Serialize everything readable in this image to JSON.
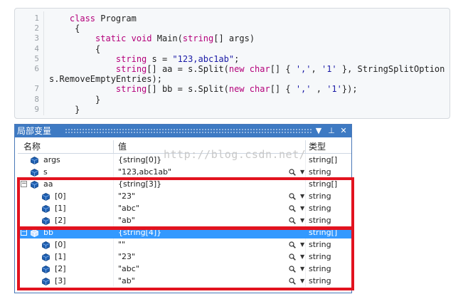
{
  "code": {
    "line_numbers": [
      "1",
      "2",
      "3",
      "4",
      "5",
      "6",
      "",
      "7",
      "8",
      "9"
    ],
    "lines": [
      [
        {
          "t": "    "
        },
        {
          "t": "class",
          "c": "kw"
        },
        {
          "t": " Program"
        }
      ],
      [
        {
          "t": "     {"
        }
      ],
      [
        {
          "t": "         "
        },
        {
          "t": "static",
          "c": "kw"
        },
        {
          "t": " "
        },
        {
          "t": "void",
          "c": "kw"
        },
        {
          "t": " Main("
        },
        {
          "t": "string",
          "c": "ty"
        },
        {
          "t": "[] args)"
        }
      ],
      [
        {
          "t": "         {"
        }
      ],
      [
        {
          "t": "             "
        },
        {
          "t": "string",
          "c": "ty"
        },
        {
          "t": " s = "
        },
        {
          "t": "\"123,abc1ab\"",
          "c": "st"
        },
        {
          "t": ";"
        }
      ],
      [
        {
          "t": "             "
        },
        {
          "t": "string",
          "c": "ty"
        },
        {
          "t": "[] aa = s.Split("
        },
        {
          "t": "new",
          "c": "kw"
        },
        {
          "t": " "
        },
        {
          "t": "char",
          "c": "ty"
        },
        {
          "t": "[] { "
        },
        {
          "t": "','",
          "c": "st"
        },
        {
          "t": ", "
        },
        {
          "t": "'1'",
          "c": "st"
        },
        {
          "t": " }, StringSplitOption"
        }
      ],
      [
        {
          "t": "s.RemoveEmptyEntries);"
        }
      ],
      [
        {
          "t": "             "
        },
        {
          "t": "string",
          "c": "ty"
        },
        {
          "t": "[] bb = s.Split("
        },
        {
          "t": "new",
          "c": "kw"
        },
        {
          "t": " "
        },
        {
          "t": "char",
          "c": "ty"
        },
        {
          "t": "[] { "
        },
        {
          "t": "','",
          "c": "st"
        },
        {
          "t": " , "
        },
        {
          "t": "'1'",
          "c": "st"
        },
        {
          "t": "});"
        }
      ],
      [
        {
          "t": "         }"
        }
      ],
      [
        {
          "t": "     }"
        }
      ]
    ]
  },
  "locals": {
    "title": "局部变量",
    "buttons": {
      "dropdown": "▼",
      "pin": "⊥",
      "close": "✕"
    },
    "columns": {
      "name": "名称",
      "value": "值",
      "type": "类型"
    },
    "rows": [
      {
        "name": "args",
        "value": "{string[0]}",
        "type": "string[]",
        "level": 0,
        "expander": "",
        "search": false,
        "selected": false
      },
      {
        "name": "s",
        "value": "\"123,abc1ab\"",
        "type": "string",
        "level": 0,
        "expander": "",
        "search": true,
        "selected": false
      },
      {
        "name": "aa",
        "value": "{string[3]}",
        "type": "string[]",
        "level": 0,
        "expander": "−",
        "search": false,
        "selected": false
      },
      {
        "name": "[0]",
        "value": "\"23\"",
        "type": "string",
        "level": 1,
        "expander": "",
        "search": true,
        "selected": false
      },
      {
        "name": "[1]",
        "value": "\"abc\"",
        "type": "string",
        "level": 1,
        "expander": "",
        "search": true,
        "selected": false
      },
      {
        "name": "[2]",
        "value": "\"ab\"",
        "type": "string",
        "level": 1,
        "expander": "",
        "search": true,
        "selected": false
      },
      {
        "name": "bb",
        "value": "{string[4]}",
        "type": "string[]",
        "level": 0,
        "expander": "−",
        "search": false,
        "selected": true
      },
      {
        "name": "[0]",
        "value": "\"\"",
        "type": "string",
        "level": 1,
        "expander": "",
        "search": true,
        "selected": false
      },
      {
        "name": "[1]",
        "value": "\"23\"",
        "type": "string",
        "level": 1,
        "expander": "",
        "search": true,
        "selected": false
      },
      {
        "name": "[2]",
        "value": "\"abc\"",
        "type": "string",
        "level": 1,
        "expander": "",
        "search": true,
        "selected": false
      },
      {
        "name": "[3]",
        "value": "\"ab\"",
        "type": "string",
        "level": 1,
        "expander": "",
        "search": true,
        "selected": false
      }
    ]
  },
  "watermark": "http://blog.csdn.net/",
  "colors": {
    "highlight_box": "#e2131f",
    "title_bar": "#3e7ac3",
    "selection": "#3399ff"
  }
}
